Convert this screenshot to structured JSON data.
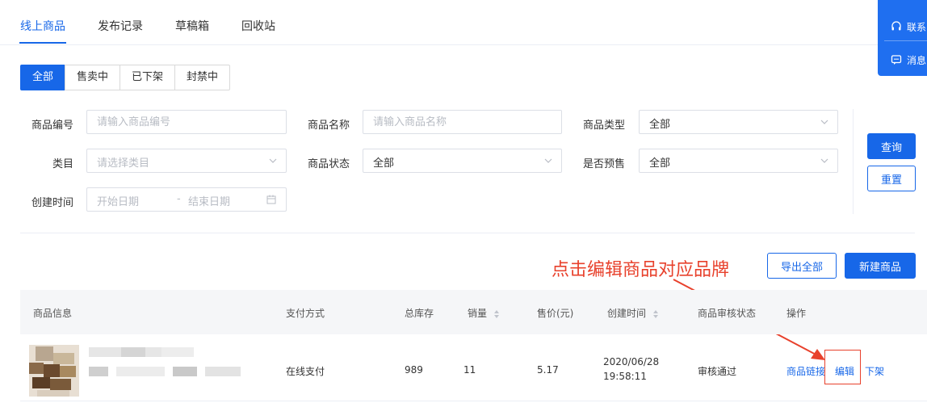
{
  "tabs": [
    "线上商品",
    "发布记录",
    "草稿箱",
    "回收站"
  ],
  "float_panel": {
    "contact_label": "联系",
    "message_label": "消息"
  },
  "status_filter": [
    "全部",
    "售卖中",
    "已下架",
    "封禁中"
  ],
  "form": {
    "product_id": {
      "label": "商品编号",
      "placeholder": "请输入商品编号"
    },
    "product_name": {
      "label": "商品名称",
      "placeholder": "请输入商品名称"
    },
    "product_type": {
      "label": "商品类型",
      "value": "全部"
    },
    "category": {
      "label": "类目",
      "placeholder": "请选择类目"
    },
    "product_status": {
      "label": "商品状态",
      "value": "全部"
    },
    "presale": {
      "label": "是否预售",
      "value": "全部"
    },
    "created_time": {
      "label": "创建时间",
      "start_placeholder": "开始日期",
      "separator": "-",
      "end_placeholder": "结束日期"
    }
  },
  "buttons": {
    "query": "查询",
    "reset": "重置",
    "export_all": "导出全部",
    "new_product": "新建商品"
  },
  "annotation": "点击编辑商品对应品牌",
  "table": {
    "headers": [
      "商品信息",
      "支付方式",
      "总库存",
      "销量",
      "售价(元)",
      "创建时间",
      "商品审核状态",
      "操作"
    ],
    "rows": [
      {
        "payment": "在线支付",
        "stock": "989",
        "sales": "11",
        "price": "5.17",
        "created_date": "2020/06/28",
        "created_time": "19:58:11",
        "audit_status": "审核通过",
        "actions": [
          "商品链接",
          "编辑",
          "下架"
        ]
      }
    ]
  },
  "colors": {
    "primary": "#1767e8",
    "annotation": "#e8412c"
  }
}
